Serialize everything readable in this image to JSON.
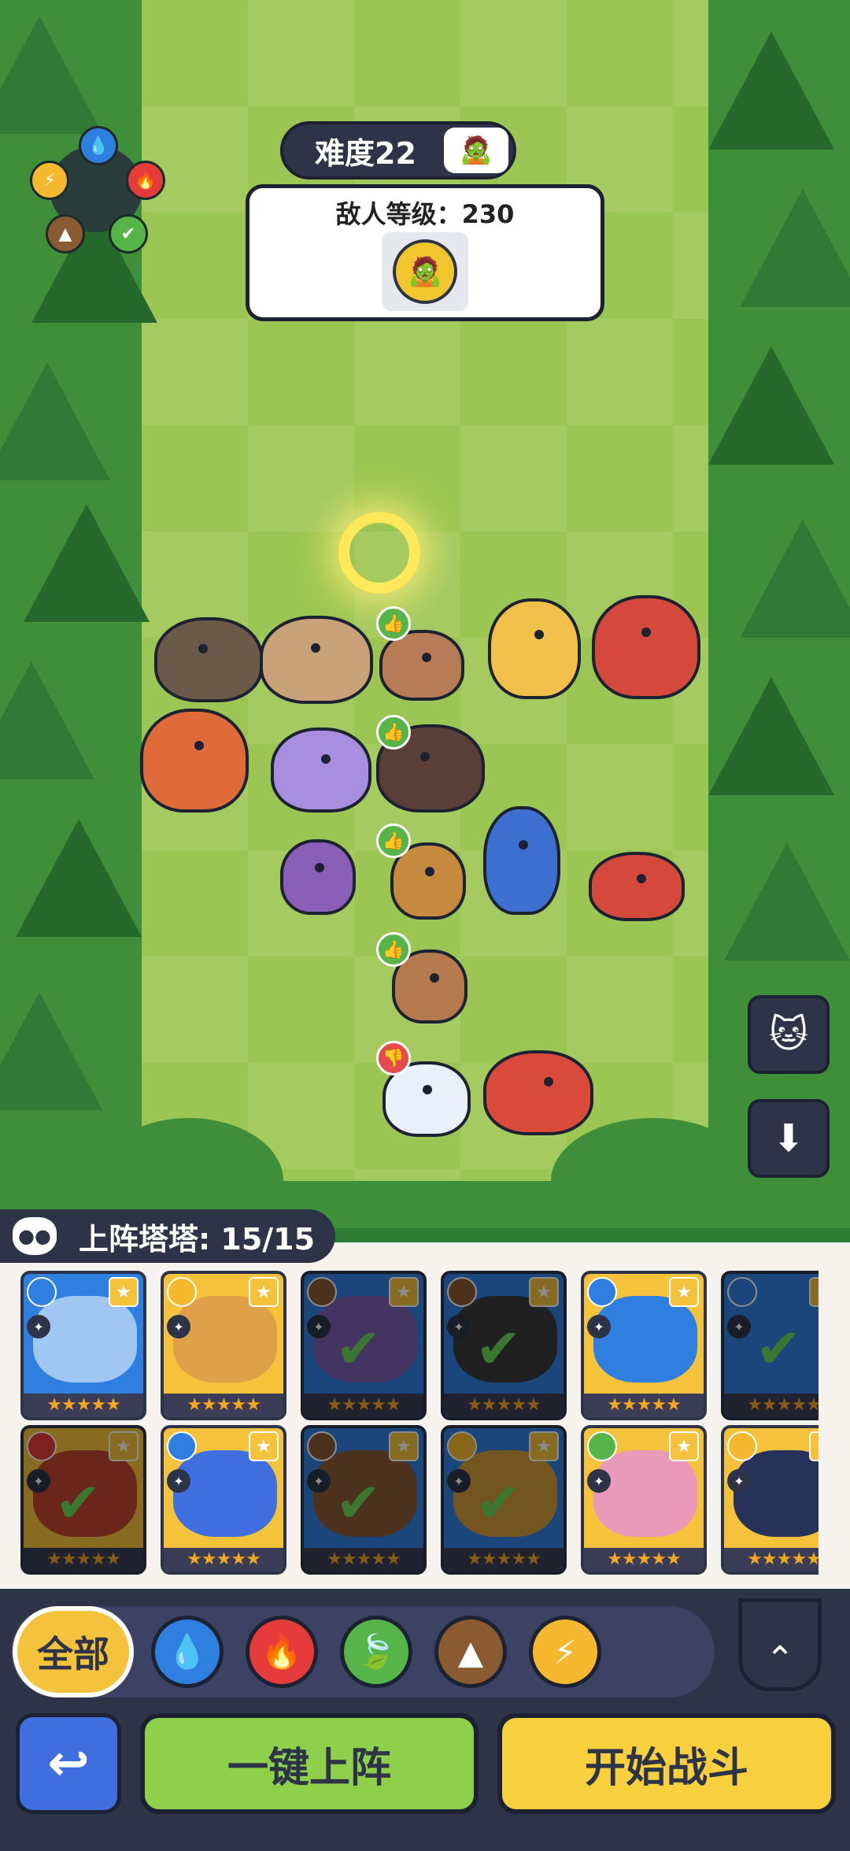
{
  "difficulty": {
    "label": "难度22"
  },
  "enemy": {
    "level_label": "敌人等级：230"
  },
  "deployed": {
    "label": "上阵塔塔: 15/15"
  },
  "filters": {
    "all_label": "全部",
    "elements": [
      "water",
      "fire",
      "leaf",
      "earth",
      "lightning"
    ]
  },
  "actions": {
    "auto_deploy_label": "一键上阵",
    "start_battle_label": "开始战斗"
  },
  "icons": {
    "water": "water-drop-icon",
    "fire": "flame-icon",
    "leaf": "leaf-icon",
    "earth": "mountain-icon",
    "lightning": "lightning-icon"
  },
  "colors": {
    "water": "#2f7fe0",
    "fire": "#e53b3b",
    "leaf": "#55b548",
    "earth": "#8a5a33",
    "lightning": "#f5b82e",
    "panel_dark": "#2d3448",
    "deploy_green": "#8ed04a",
    "start_yellow": "#f8cf3d"
  },
  "cards": [
    {
      "color": "blue",
      "element": "water",
      "stars": "★★★★★",
      "selected": false
    },
    {
      "color": "gold",
      "element": "lightning",
      "stars": "★★★★★",
      "selected": false
    },
    {
      "color": "blue",
      "element": "earth",
      "stars": "★★★★★",
      "selected": true
    },
    {
      "color": "blue",
      "element": "earth",
      "stars": "★★★★★",
      "selected": true
    },
    {
      "color": "gold",
      "element": "water",
      "stars": "★★★★★",
      "selected": false
    },
    {
      "color": "blue",
      "element": "water",
      "stars": "★★★★★",
      "selected": true
    },
    {
      "color": "gold",
      "element": "fire",
      "stars": "★★★★★",
      "selected": true
    },
    {
      "color": "gold",
      "element": "water",
      "stars": "★★★★★",
      "selected": false
    },
    {
      "color": "blue",
      "element": "earth",
      "stars": "★★★★★",
      "selected": true
    },
    {
      "color": "blue",
      "element": "lightning",
      "stars": "★★★★★",
      "selected": true
    },
    {
      "color": "gold",
      "element": "leaf",
      "stars": "★★★★★",
      "selected": false
    },
    {
      "color": "gold",
      "element": "lightning",
      "stars": "★★★★★",
      "selected": false
    }
  ]
}
